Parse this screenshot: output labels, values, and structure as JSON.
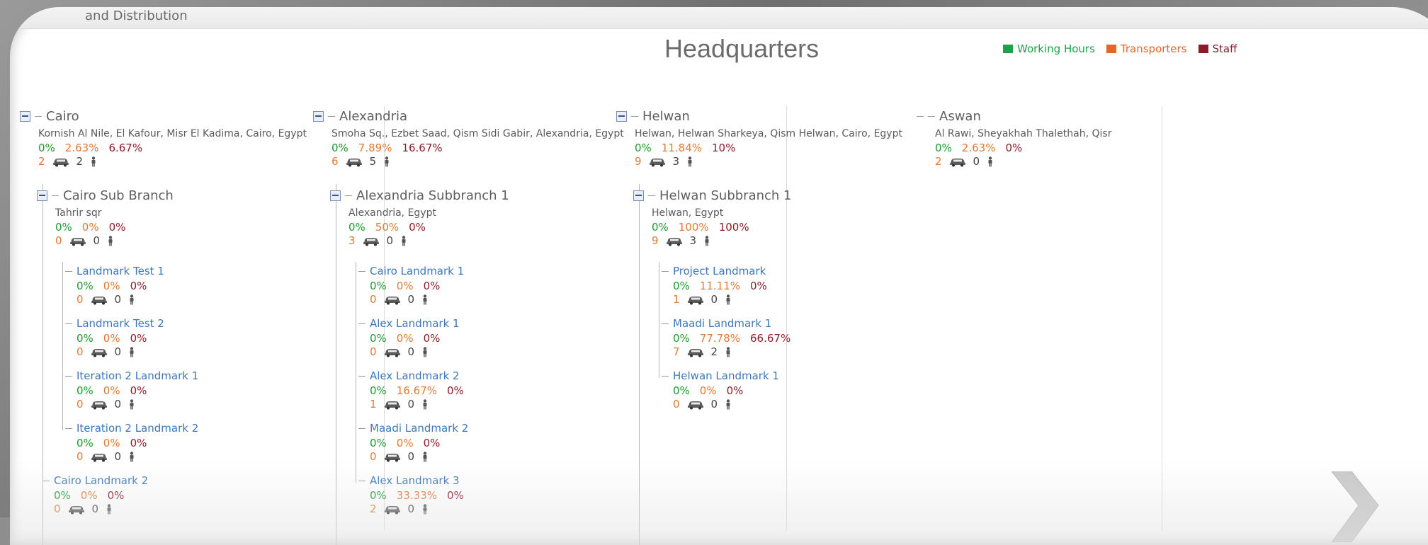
{
  "app": {
    "title": "and Distribution"
  },
  "page": {
    "title": "Headquarters"
  },
  "legend": [
    {
      "label": "Working Hours",
      "color": "#1fa04a"
    },
    {
      "label": "Transporters",
      "color": "#e2672e"
    },
    {
      "label": "Staff",
      "color": "#8b1a2b"
    }
  ],
  "cities": [
    {
      "name": "Cairo",
      "address": "Kornish Al Nile, El Kafour, Misr El Kadima, Cairo, Egypt",
      "pct": [
        "0%",
        "2.63%",
        "6.67%"
      ],
      "transporters": "2",
      "staff": "2",
      "sub": {
        "name": "Cairo Sub Branch",
        "address": "Tahrir sqr",
        "pct": [
          "0%",
          "0%",
          "0%"
        ],
        "transporters": "0",
        "staff": "0",
        "landmarks": [
          {
            "name": "Landmark Test 1",
            "pct": [
              "0%",
              "0%",
              "0%"
            ],
            "transporters": "0",
            "staff": "0"
          },
          {
            "name": "Landmark Test 2",
            "pct": [
              "0%",
              "0%",
              "0%"
            ],
            "transporters": "0",
            "staff": "0"
          },
          {
            "name": "Iteration 2 Landmark 1",
            "pct": [
              "0%",
              "0%",
              "0%"
            ],
            "transporters": "0",
            "staff": "0"
          },
          {
            "name": "Iteration 2 Landmark 2",
            "pct": [
              "0%",
              "0%",
              "0%"
            ],
            "transporters": "0",
            "staff": "0"
          }
        ]
      },
      "landmarks": [
        {
          "name": "Cairo Landmark 2",
          "pct": [
            "0%",
            "0%",
            "0%"
          ],
          "transporters": "0",
          "staff": "0"
        }
      ]
    },
    {
      "name": "Alexandria",
      "address": "Smoha Sq., Ezbet Saad, Qism Sidi Gabir, Alexandria, Egypt",
      "pct": [
        "0%",
        "7.89%",
        "16.67%"
      ],
      "transporters": "6",
      "staff": "5",
      "sub": {
        "name": "Alexandria Subbranch 1",
        "address": "Alexandria, Egypt",
        "pct": [
          "0%",
          "50%",
          "0%"
        ],
        "transporters": "3",
        "staff": "0",
        "landmarks": [
          {
            "name": "Cairo Landmark 1",
            "pct": [
              "0%",
              "0%",
              "0%"
            ],
            "transporters": "0",
            "staff": "0"
          },
          {
            "name": "Alex Landmark 1",
            "pct": [
              "0%",
              "0%",
              "0%"
            ],
            "transporters": "0",
            "staff": "0"
          },
          {
            "name": "Alex Landmark 2",
            "pct": [
              "0%",
              "16.67%",
              "0%"
            ],
            "transporters": "1",
            "staff": "0"
          },
          {
            "name": "Maadi Landmark 2",
            "pct": [
              "0%",
              "0%",
              "0%"
            ],
            "transporters": "0",
            "staff": "0"
          },
          {
            "name": "Alex Landmark 3",
            "pct": [
              "0%",
              "33.33%",
              "0%"
            ],
            "transporters": "2",
            "staff": "0"
          }
        ]
      }
    },
    {
      "name": "Helwan",
      "address": "Helwan, Helwan Sharkeya, Qism Helwan, Cairo, Egypt",
      "pct": [
        "0%",
        "11.84%",
        "10%"
      ],
      "transporters": "9",
      "staff": "3",
      "sub": {
        "name": "Helwan Subbranch 1",
        "address": "Helwan, Egypt",
        "pct": [
          "0%",
          "100%",
          "100%"
        ],
        "transporters": "9",
        "staff": "3",
        "landmarks": [
          {
            "name": "Project Landmark",
            "pct": [
              "0%",
              "11.11%",
              "0%"
            ],
            "transporters": "1",
            "staff": "0"
          },
          {
            "name": "Maadi Landmark 1",
            "pct": [
              "0%",
              "77.78%",
              "66.67%"
            ],
            "transporters": "7",
            "staff": "2"
          },
          {
            "name": "Helwan Landmark 1",
            "pct": [
              "0%",
              "0%",
              "0%"
            ],
            "transporters": "0",
            "staff": "0"
          }
        ]
      }
    },
    {
      "name": "Aswan",
      "address": "Al Rawi, Sheyakhah Thalethah, Qisr",
      "pct": [
        "0%",
        "2.63%",
        "0%"
      ],
      "transporters": "2",
      "staff": "0"
    }
  ]
}
